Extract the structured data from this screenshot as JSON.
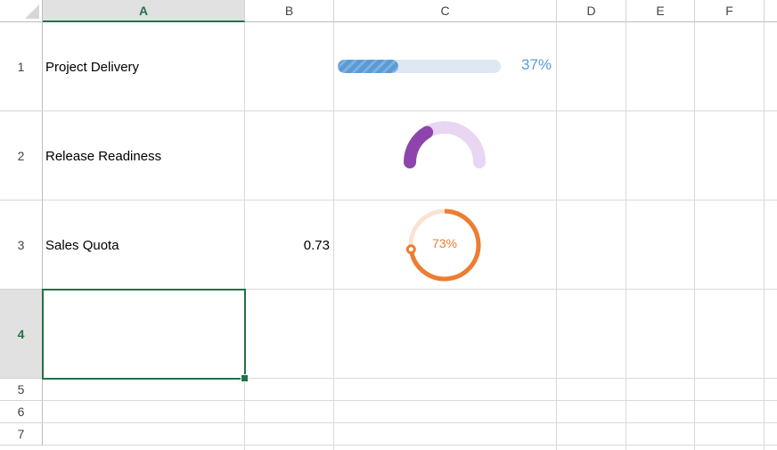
{
  "columns": [
    "A",
    "B",
    "C",
    "D",
    "E",
    "F"
  ],
  "selected_column": "A",
  "rows": [
    "1",
    "2",
    "3",
    "4",
    "5",
    "6",
    "7"
  ],
  "selected_row": "4",
  "cells": {
    "A1": "Project Delivery",
    "A2": "Release Readiness",
    "A3": "Sales Quota",
    "B3": "0.73"
  },
  "widgets": {
    "progress_bar": {
      "fraction": 0.37,
      "label": "37%",
      "color": "#5b9bd5",
      "track_color": "#dde8f3"
    },
    "gauge": {
      "fraction": 0.33,
      "color": "#8e44ad",
      "track_color": "#e8d6f3"
    },
    "ring": {
      "fraction": 0.73,
      "label": "73%",
      "color": "#ed7d31",
      "track_color": "#fbe3d2"
    }
  },
  "colors": {
    "accent": "#217346"
  }
}
